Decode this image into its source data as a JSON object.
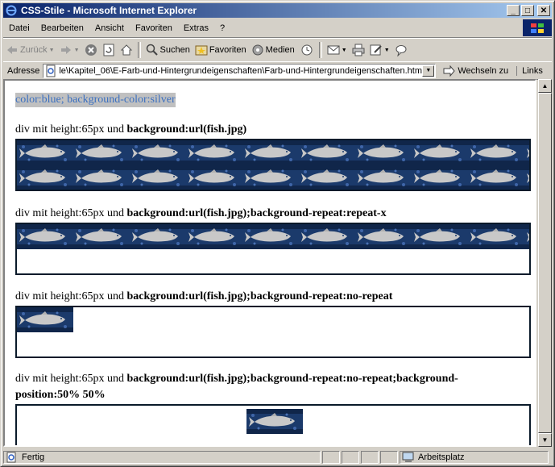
{
  "window": {
    "title": "CSS-Stile - Microsoft Internet Explorer"
  },
  "menu": [
    "Datei",
    "Bearbeiten",
    "Ansicht",
    "Favoriten",
    "Extras",
    "?"
  ],
  "toolbar": {
    "back": "Zurück",
    "search": "Suchen",
    "favorites": "Favoriten",
    "media": "Medien"
  },
  "address": {
    "label": "Adresse",
    "value": "le\\Kapitel_06\\E-Farb-und-Hintergrundeigenschaften\\Farb-und-Hintergrundeigenschaften.htm",
    "go": "Wechseln zu",
    "links": "Links"
  },
  "page": {
    "styled_text": "color:blue; background-color:silver",
    "prefix": "div mit height:65px und",
    "blocks": [
      {
        "rule": "background:url(fish.jpg)"
      },
      {
        "rule": "background:url(fish.jpg);background-repeat:repeat-x"
      },
      {
        "rule": "background:url(fish.jpg);background-repeat:no-repeat"
      },
      {
        "rule_line1": "background:url(fish.jpg);background-repeat:no-repeat;background-",
        "rule_line2": "position:50% 50%"
      }
    ]
  },
  "status": {
    "text": "Fertig",
    "zone": "Arbeitsplatz"
  },
  "colors": {
    "title_start": "#0a246a",
    "title_end": "#a6caf0",
    "styled_text": "#3a6fc0",
    "styled_bg": "#c0c0c0",
    "fish_bg": "#1b3a6b"
  }
}
